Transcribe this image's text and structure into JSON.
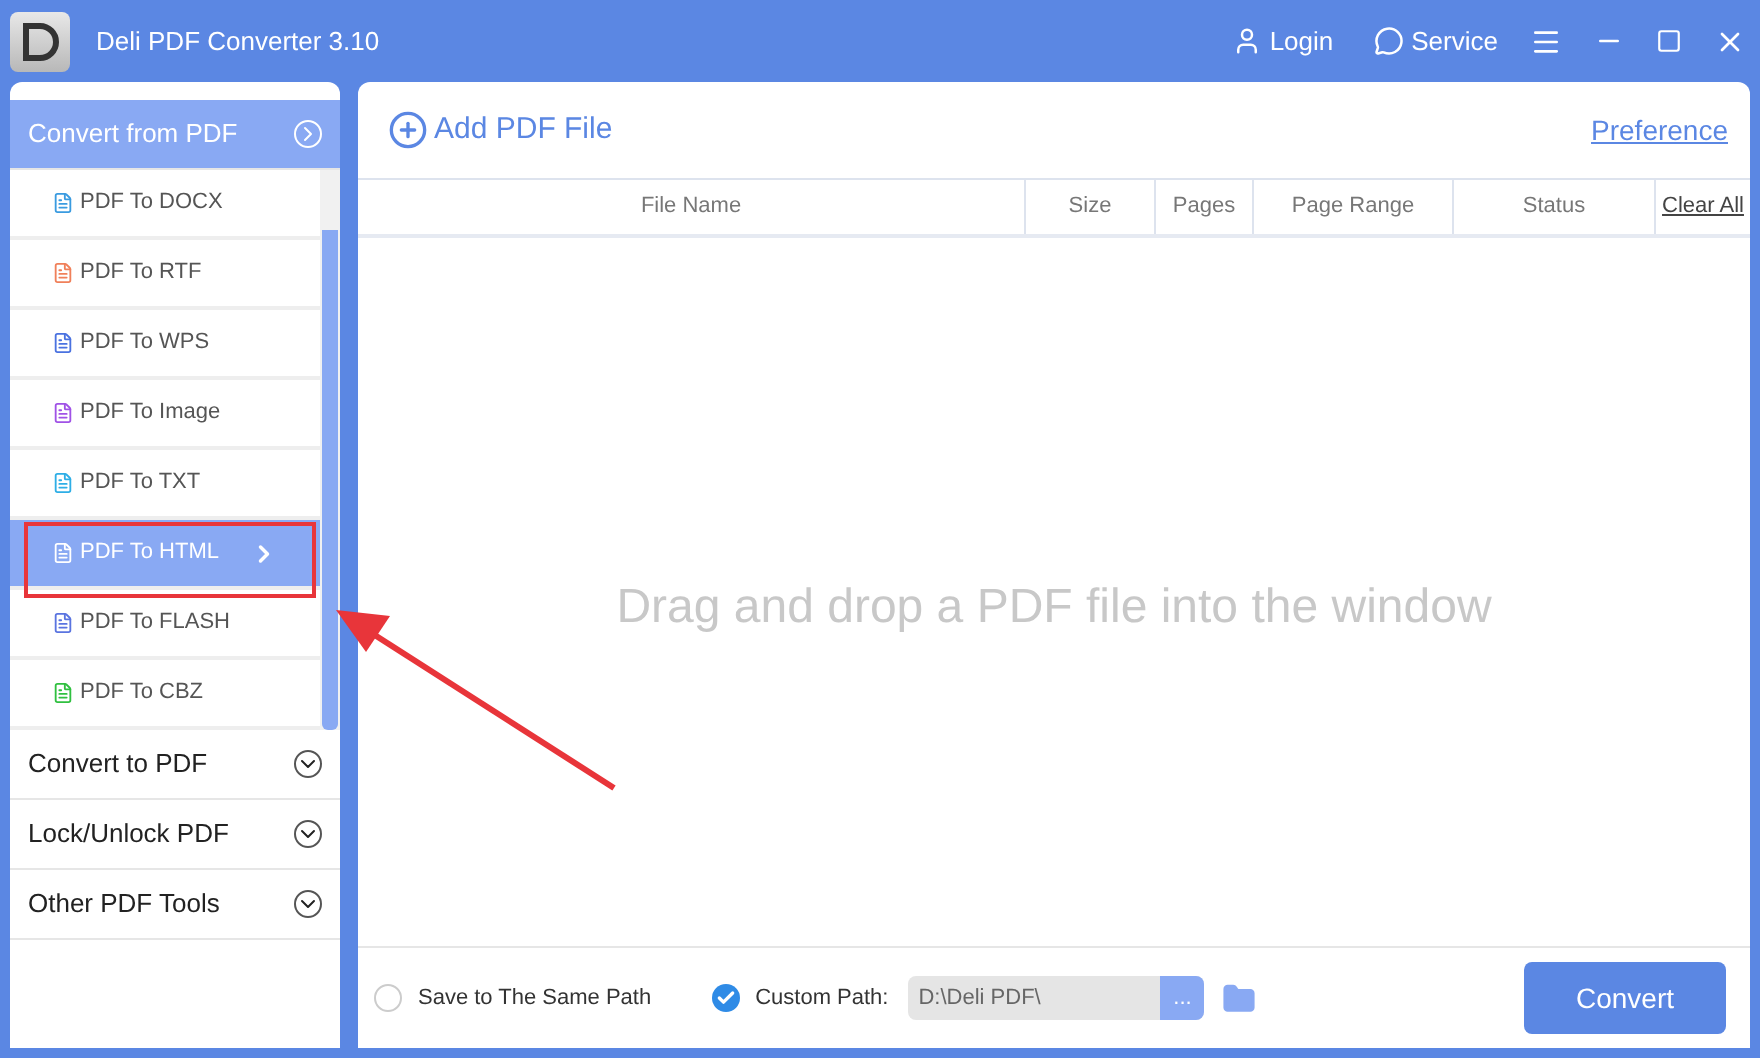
{
  "window": {
    "title": "Deli PDF Converter 3.10",
    "actions": [
      "Login",
      "Service"
    ]
  },
  "sidebar": {
    "sections": [
      {
        "label": "Convert from PDF",
        "expanded": true,
        "items": [
          {
            "label": "PDF To DOCX",
            "color": "#3a9be0",
            "selected": false
          },
          {
            "label": "PDF To RTF",
            "color": "#f0805a",
            "selected": false
          },
          {
            "label": "PDF To WPS",
            "color": "#4a72e0",
            "selected": false
          },
          {
            "label": "PDF To Image",
            "color": "#a052e6",
            "selected": false
          },
          {
            "label": "PDF To TXT",
            "color": "#2eaee6",
            "selected": false
          },
          {
            "label": "PDF To HTML",
            "color": "#ffffff",
            "selected": true
          },
          {
            "label": "PDF To FLASH",
            "color": "#5a74e0",
            "selected": false
          },
          {
            "label": "PDF To CBZ",
            "color": "#30c040",
            "selected": false
          }
        ]
      },
      {
        "label": "Convert to PDF",
        "expanded": false
      },
      {
        "label": "Lock/Unlock PDF",
        "expanded": false
      },
      {
        "label": "Other PDF Tools",
        "expanded": false
      }
    ]
  },
  "toolbar": {
    "add": "Add PDF File",
    "preference": "Preference"
  },
  "table": {
    "columns": [
      "File Name",
      "Size",
      "Pages",
      "Page Range",
      "Status"
    ],
    "clear": "Clear All",
    "empty": "Drag and drop a PDF file into the window"
  },
  "footer": {
    "options": [
      {
        "label": "Save to The Same Path",
        "selected": false
      },
      {
        "label": "Custom Path:",
        "selected": true
      }
    ],
    "path": "D:\\Deli PDF\\",
    "browse": "...",
    "convert": "Convert"
  }
}
